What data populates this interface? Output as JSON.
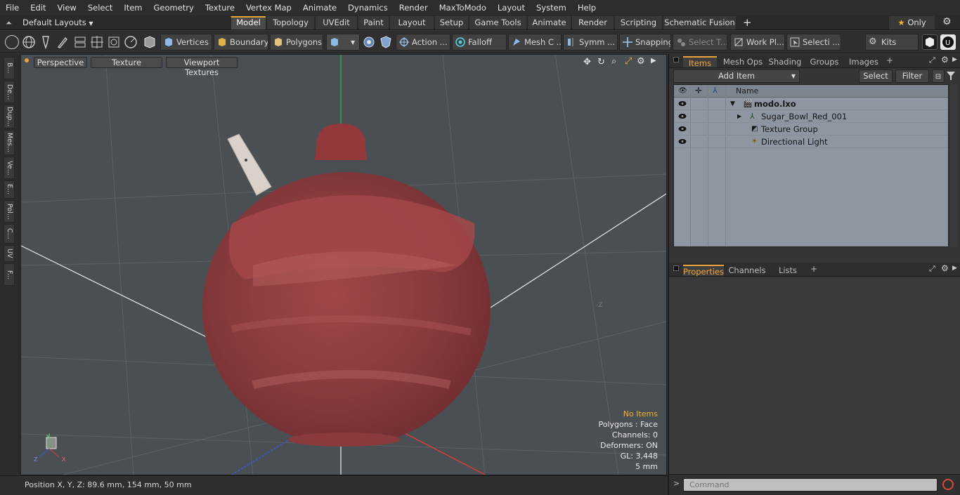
{
  "menu": [
    "File",
    "Edit",
    "View",
    "Select",
    "Item",
    "Geometry",
    "Texture",
    "Vertex Map",
    "Animate",
    "Dynamics",
    "Render",
    "MaxToModo",
    "Layout",
    "System",
    "Help"
  ],
  "layout_selector": "Default Layouts",
  "layout_tabs": [
    "Model",
    "Topology",
    "UVEdit",
    "Paint",
    "Layout",
    "Setup",
    "Game Tools",
    "Animate",
    "Render",
    "Scripting",
    "Schematic Fusion"
  ],
  "layout_active": "Model",
  "only_label": "Only",
  "toolbar": {
    "vertices": "Vertices",
    "boundary": "Boundary",
    "polygons": "Polygons",
    "action": "Action ...",
    "falloff": "Falloff",
    "mesh": "Mesh C ...",
    "symm": "Symm ...",
    "snapping": "Snapping",
    "select_t": "Select T...",
    "work_pl": "Work Pl...",
    "selecti": "Selecti ...",
    "kits": "Kits"
  },
  "left_tabs": [
    "B...",
    "De...",
    "Dup...",
    "Mes...",
    "Ve...",
    "E...",
    "Pol...",
    "C...",
    "UV",
    "F..."
  ],
  "viewport": {
    "perspective": "Perspective",
    "texture": "Texture",
    "viewport_textures": "Viewport Textures",
    "info": {
      "no_items": "No Items",
      "polygons": "Polygons : Face",
      "channels": "Channels: 0",
      "deformers": "Deformers: ON",
      "gl": "GL: 3,448",
      "scale": "5 mm"
    },
    "axis_minus_z": "-Z"
  },
  "status": {
    "position": "Position X, Y, Z:  89.6 mm, 154 mm, 50 mm"
  },
  "items_panel": {
    "tabs": [
      "Items",
      "Mesh Ops",
      "Shading",
      "Groups",
      "Images"
    ],
    "active": "Items",
    "add_item": "Add Item",
    "select": "Select",
    "filter": "Filter",
    "column_name": "Name",
    "rows": [
      "modo.lxo",
      "Sugar_Bowl_Red_001",
      "Texture Group",
      "Directional Light"
    ]
  },
  "properties_panel": {
    "tabs": [
      "Properties",
      "Channels",
      "Lists"
    ],
    "active": "Properties"
  },
  "command": {
    "placeholder": "Command"
  },
  "colors": {
    "accent": "#e8a33b",
    "bowl": "#8a3336",
    "viewport_bg": "#4a4f53"
  }
}
